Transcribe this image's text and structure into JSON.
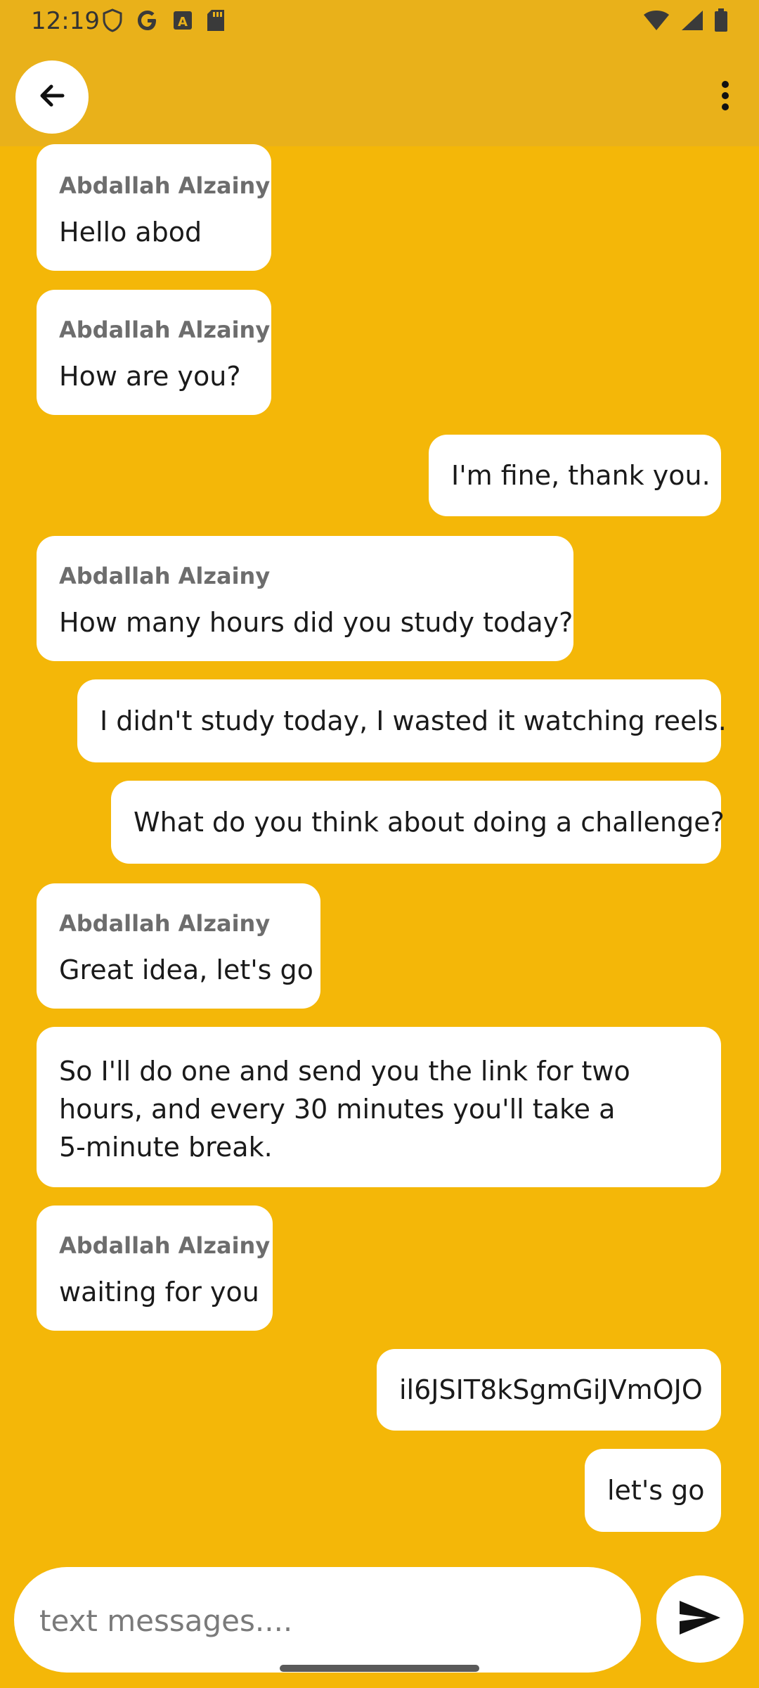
{
  "status_bar": {
    "time": "12:19",
    "left_icons": [
      "shield-icon",
      "google-icon",
      "a-badge-icon",
      "sd-card-icon"
    ],
    "right_icons": [
      "wifi-icon",
      "signal-icon",
      "battery-icon"
    ]
  },
  "app_bar": {
    "back_icon": "arrow-left-icon",
    "menu_icon": "more-vert-icon"
  },
  "messages": [
    {
      "direction": "in",
      "sender": "Abdallah Alzainy",
      "text": "Hello abod"
    },
    {
      "direction": "in",
      "sender": "Abdallah Alzainy",
      "text": "How are you?"
    },
    {
      "direction": "out",
      "text": "I'm fine, thank you."
    },
    {
      "direction": "in",
      "sender": "Abdallah Alzainy",
      "text": "How many hours did you study today?"
    },
    {
      "direction": "out",
      "text": "I didn't study today, I wasted it watching reels."
    },
    {
      "direction": "out",
      "text": "What do you think about doing a challenge?"
    },
    {
      "direction": "in",
      "sender": "Abdallah Alzainy",
      "text": "Great idea, let's go"
    },
    {
      "direction": "out",
      "text": "So I'll do one and send you the link for two hours, and every 30 minutes you'll take a 5-minute break."
    },
    {
      "direction": "in",
      "sender": "Abdallah Alzainy",
      "text": "waiting for you"
    },
    {
      "direction": "out",
      "text": "il6JSIT8kSgmGiJVmOJO"
    },
    {
      "direction": "out",
      "text": "let's go"
    }
  ],
  "composer": {
    "placeholder": "text messages....",
    "send_icon": "send-icon"
  },
  "colors": {
    "background": "#F4B708",
    "app_bar": "#E9B11A",
    "bubble": "#FFFFFF",
    "sender": "#6D6D6D"
  }
}
